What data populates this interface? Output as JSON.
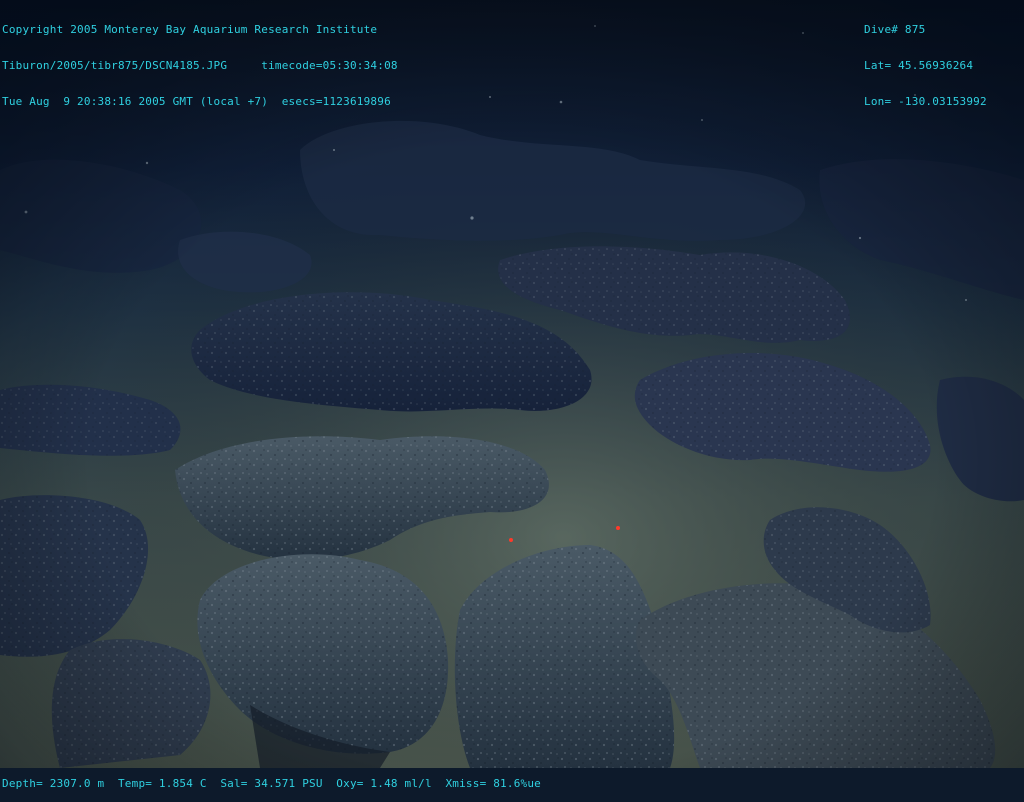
{
  "overlay": {
    "top_left": {
      "copyright": "Copyright 2005 Monterey Bay Aquarium Research Institute",
      "file_line": "Tiburon/2005/tibr875/DSCN4185.JPG     timecode=05:30:34:08",
      "time_line": "Tue Aug  9 20:38:16 2005 GMT (local +7)  esecs=1123619896"
    },
    "top_right": {
      "dive": "Dive# 875",
      "lat": "Lat= 45.56936264",
      "lon": "Lon= -130.03153992"
    },
    "bottom": {
      "sensors": "Depth= 2307.0 m  Temp= 1.854 C  Sal= 34.571 PSU  Oxy= 1.48 ml/l  Xmiss= 81.6%ue"
    },
    "text_color": "#2fd0e0"
  },
  "scene": {
    "subject": "deep-sea floor with pillow lava boulders and sediment",
    "laser_dots": 2,
    "laser_color": "#ff3a2a",
    "water_color": "#0d1a2b",
    "sediment_color": "#4a5a55",
    "rock_color": "#2c3a46"
  }
}
